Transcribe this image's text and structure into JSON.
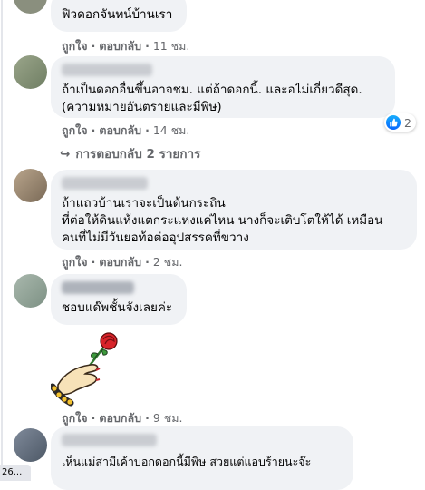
{
  "comments": [
    {
      "text": "ฟิวดอกจันทน์บ้านเรา",
      "like": "ถูกใจ",
      "reply": "ตอบกลับ",
      "time": "11 ชม."
    },
    {
      "text": "ถ้าเป็นดอกอื่นขึ้นอาจชม. แต่ถ้าดอกนี้. และอไม่เกี่ยวดีสุด.\n(ความหมายอันตรายและมีพิษ)",
      "like": "ถูกใจ",
      "reply": "ตอบกลับ",
      "time": "14 ชม.",
      "reaction_count": "2",
      "replies_label": "การตอบกลับ 2 รายการ"
    },
    {
      "text": "ถ้าแถวบ้านเราจะเป็นต้นกระถิน\nที่ต่อให้ดินแห้งแตกระแหงแค่ไหน นางก็จะเติบโตให้ได้ เหมือน\nคนที่ไม่มีวันยอท้อต่ออุปสรรคที่ขวาง",
      "like": "ถูกใจ",
      "reply": "ตอบกลับ",
      "time": "2 ชม."
    },
    {
      "text": "ชอบแด๊พชั้นจังเลยค่ะ",
      "like": "ถูกใจ",
      "reply": "ตอบกลับ",
      "time": "9 ชม."
    },
    {
      "text": "เห็นแม่สามีเค้าบอกดอกนี้มีพิษ สวยแต่แอบร้ายนะจ๊ะ"
    }
  ],
  "sticker": {
    "icon": "hand-holding-rose-sticker"
  },
  "bottom_chip": "26...",
  "colors": {
    "bubble": "#f0f2f5",
    "meta": "#65676b",
    "like_blue": "#0866ff"
  }
}
